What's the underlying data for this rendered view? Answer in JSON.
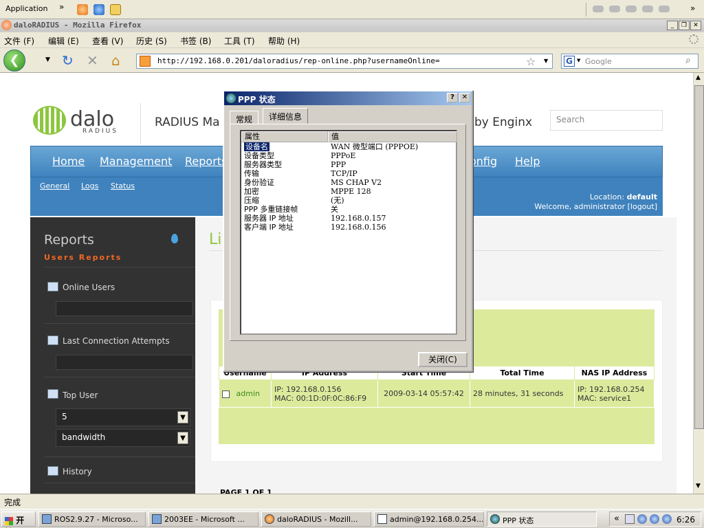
{
  "quicklaunch": {
    "label": "Application",
    "chevron": "»"
  },
  "window": {
    "title": "daloRADIUS - Mozilla Firefox"
  },
  "menu": [
    "文件 (F)",
    "编辑 (E)",
    "查看 (V)",
    "历史 (S)",
    "书签 (B)",
    "工具 (T)",
    "帮助 (H)"
  ],
  "toolbar": {
    "url": "http://192.168.0.201/daloradius/rep-online.php?usernameOnline=",
    "search_placeholder": "Google"
  },
  "site": {
    "logo_text": "dalo",
    "logo_sub": "RADIUS",
    "title_left": "RADIUS Ma",
    "title_right": "by Enginx",
    "search_placeholder": "Search",
    "nav": [
      "Home",
      "Management",
      "Reports",
      "onfig",
      "Help"
    ],
    "subnav": [
      "General",
      "Logs",
      "Status"
    ],
    "location_label": "Location:",
    "location_value": "default",
    "welcome": "Welcome, administrator",
    "logout": "[logout]"
  },
  "sidebar": {
    "title": "Reports",
    "subtitle": "Users Reports",
    "items": [
      "Online Users",
      "Last Connection Attempts",
      "Top User",
      "History"
    ],
    "top_count": "5",
    "top_metric": "bandwidth"
  },
  "main": {
    "title": "Li",
    "table_headers": [
      "Username",
      "IP Address",
      "Start Time",
      "Total Time",
      "NAS IP Address"
    ],
    "row": {
      "username": "admin",
      "ip": "IP: 192.168.0.156",
      "mac": "MAC: 00:1D:0F:0C:86:F9",
      "start": "2009-03-14 05:57:42",
      "total": "28 minutes, 31 seconds",
      "nas_ip": "IP: 192.168.0.254",
      "nas_mac": "MAC: service1"
    },
    "pager": "PAGE 1 OF 1"
  },
  "dialog": {
    "title": "PPP 状态",
    "tabs": [
      "常规",
      "详细信息"
    ],
    "headers": [
      "属性",
      "值"
    ],
    "rows": [
      [
        "设备名",
        "WAN 微型端口 (PPPOE)"
      ],
      [
        "设备类型",
        "PPPoE"
      ],
      [
        "服务器类型",
        "PPP"
      ],
      [
        "传输",
        "TCP/IP"
      ],
      [
        "身份验证",
        "MS CHAP V2"
      ],
      [
        "加密",
        "MPPE 128"
      ],
      [
        "压缩",
        "(无)"
      ],
      [
        "PPP 多重链接帧",
        "关"
      ],
      [
        "服务器 IP 地址",
        "192.168.0.157"
      ],
      [
        "客户端 IP 地址",
        "192.168.0.156"
      ]
    ],
    "close_label": "关闭(C)"
  },
  "status": {
    "text": "完成"
  },
  "taskbar": {
    "start": "开始",
    "items": [
      "ROS2.9.27 - Microso...",
      "2003EE - Microsoft ...",
      "daloRADIUS - Mozill...",
      "admin@192.168.0.254...",
      "PPP 状态"
    ],
    "tray_chevron": "«",
    "clock": "6:26"
  }
}
